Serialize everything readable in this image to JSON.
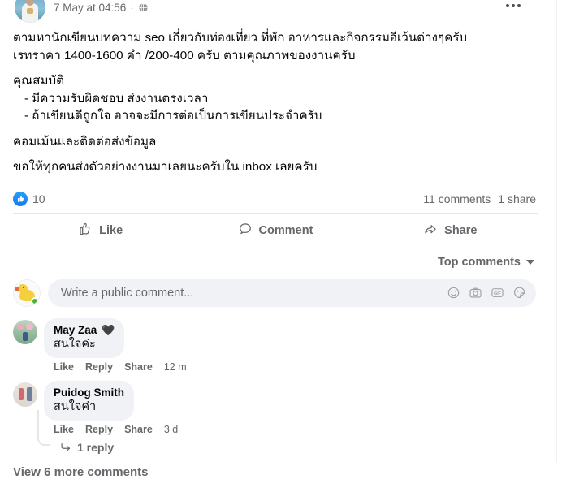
{
  "post": {
    "timestamp": "7 May at 04:56",
    "meta_separator": "·",
    "privacy_icon": "globe-icon",
    "menu_icon": "more-options-icon",
    "lines": [
      "ตามหานักเขียนบทความ seo เกี่ยวกับท่องเที่ยว ที่พัก อาหารและกิจกรรมอีเว้นต่างๆครับ",
      "เรทราคา 1400-1600 คำ /200-400 ครับ ตามคุณภาพของงานครับ",
      "คุณสมบัติ",
      "- มีความรับผิดชอบ ส่งงานตรงเวลา",
      "- ถ้าเขียนดีถูกใจ อาจจะมีการต่อเป็นการเขียนประจำครับ",
      "คอมเม้นและติดต่อส่งข้อมูล",
      "ขอให้ทุกคนส่งตัวอย่างงานมาเลยนะครับใน inbox เลยครับ"
    ]
  },
  "engagement": {
    "reaction_icon": "like-reaction-icon",
    "reaction_count": "10",
    "comments_count": "11 comments",
    "shares_count": "1 share"
  },
  "actions": [
    {
      "label": "Like",
      "icon": "thumbs-up-icon"
    },
    {
      "label": "Comment",
      "icon": "comment-bubble-icon"
    },
    {
      "label": "Share",
      "icon": "share-arrow-icon"
    }
  ],
  "sort": {
    "label": "Top comments",
    "icon": "chevron-down-icon"
  },
  "composer": {
    "placeholder": "Write a public comment...",
    "value": "",
    "avatar": "duck-avatar",
    "icons": [
      {
        "name": "emoji-icon"
      },
      {
        "name": "camera-icon"
      },
      {
        "name": "gif-icon"
      },
      {
        "name": "sticker-icon"
      }
    ]
  },
  "comments": [
    {
      "author": "May Zaa",
      "name_emoji": "🖤",
      "text": "สนใจค่ะ",
      "like_label": "Like",
      "reply_label": "Reply",
      "share_label": "Share",
      "time": "12 m"
    },
    {
      "author": "Puidog Smith",
      "name_emoji": "",
      "text": "สนใจค่า",
      "like_label": "Like",
      "reply_label": "Reply",
      "share_label": "Share",
      "time": "3 d"
    }
  ],
  "reply_thread": {
    "label": "1 reply",
    "icon": "reply-arrow-icon"
  },
  "view_more": "View 6 more comments",
  "colors": {
    "accent": "#1877f2",
    "text": "#050505",
    "muted": "#65676b",
    "bubble": "#f0f2f5",
    "online": "#42b72a"
  }
}
